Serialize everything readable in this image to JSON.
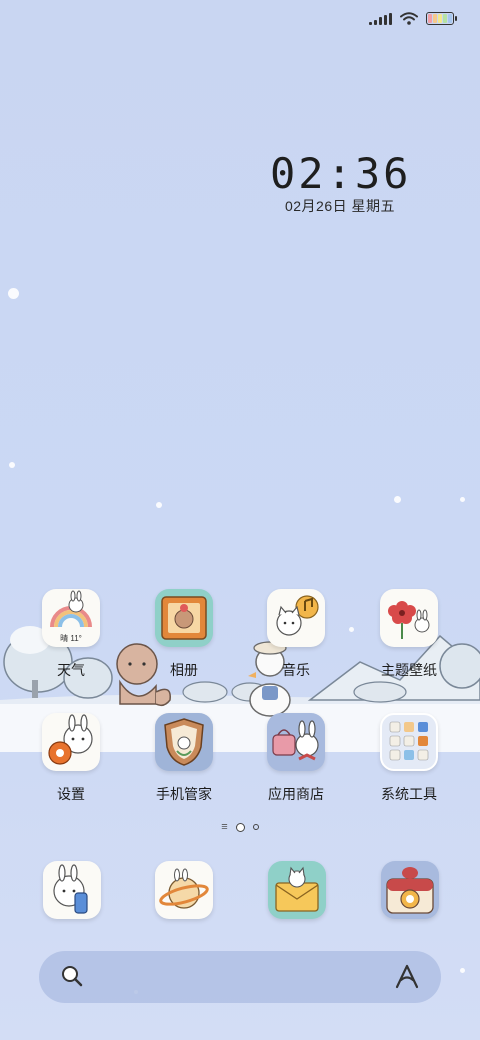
{
  "clock": {
    "time": "02:36",
    "date": "02月26日 星期五"
  },
  "weather_widget": {
    "text": "晴 11°"
  },
  "apps": [
    {
      "label": "天气",
      "icon": "rainbow-bunny-icon"
    },
    {
      "label": "相册",
      "icon": "bear-photo-frame-icon"
    },
    {
      "label": "音乐",
      "icon": "cat-music-note-icon"
    },
    {
      "label": "主题壁纸",
      "icon": "flower-bunny-icon"
    },
    {
      "label": "设置",
      "icon": "gear-bunny-icon"
    },
    {
      "label": "手机管家",
      "icon": "shield-bunny-icon"
    },
    {
      "label": "应用商店",
      "icon": "bag-bunny-icon"
    },
    {
      "label": "系统工具",
      "icon": "folder-icon"
    }
  ],
  "dock": [
    {
      "icon": "phone-bunny-icon"
    },
    {
      "icon": "planet-bunny-icon"
    },
    {
      "icon": "envelope-cat-icon"
    },
    {
      "icon": "camera-icon"
    }
  ],
  "pager": {
    "pages": 2,
    "current": 1
  },
  "search": {
    "placeholder": ""
  },
  "colors": {
    "background": "#cbd8f4",
    "snow": "#ffffff",
    "search_bar": "#b0c0e4"
  }
}
